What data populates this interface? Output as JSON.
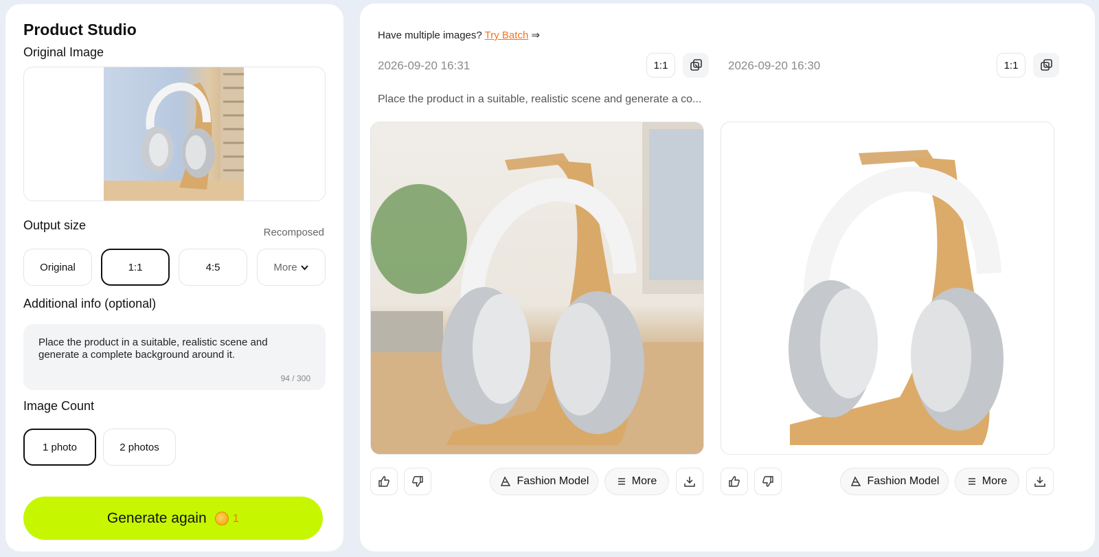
{
  "left_panel": {
    "title": "Product Studio",
    "original_image_label": "Original Image",
    "output_size": {
      "label": "Output size",
      "note": "Recomposed",
      "options": [
        "Original",
        "1:1",
        "4:5",
        "More"
      ],
      "selected": "1:1"
    },
    "additional_info": {
      "label": "Additional info (optional)",
      "value": "Place the product in a suitable, realistic scene and generate a complete background around it.",
      "counter": "94 / 300"
    },
    "image_count": {
      "label": "Image Count",
      "options": [
        "1 photo",
        "2 photos"
      ],
      "selected": "1 photo"
    },
    "generate": {
      "label": "Generate again",
      "cost": "1"
    }
  },
  "right_panel": {
    "multi_prompt": "Have multiple images?",
    "try_batch": "Try Batch",
    "arrow": "⇒",
    "results": [
      {
        "timestamp": "2026-09-20 16:31",
        "ratio": "1:1",
        "prompt": "Place the product in a suitable, realistic scene and generate a co...",
        "fashion_model_label": "Fashion Model",
        "more_label": "More"
      },
      {
        "timestamp": "2026-09-20 16:30",
        "ratio": "1:1",
        "fashion_model_label": "Fashion Model",
        "more_label": "More"
      }
    ]
  },
  "colors": {
    "accent": "#c6f700",
    "link": "#f97316",
    "coin": "#f59e0b"
  },
  "icons": [
    "thumbs-up-icon",
    "thumbs-down-icon",
    "fashion-model-icon",
    "menu-icon",
    "download-icon",
    "compare-icon",
    "chevron-down-icon",
    "coin-icon"
  ]
}
